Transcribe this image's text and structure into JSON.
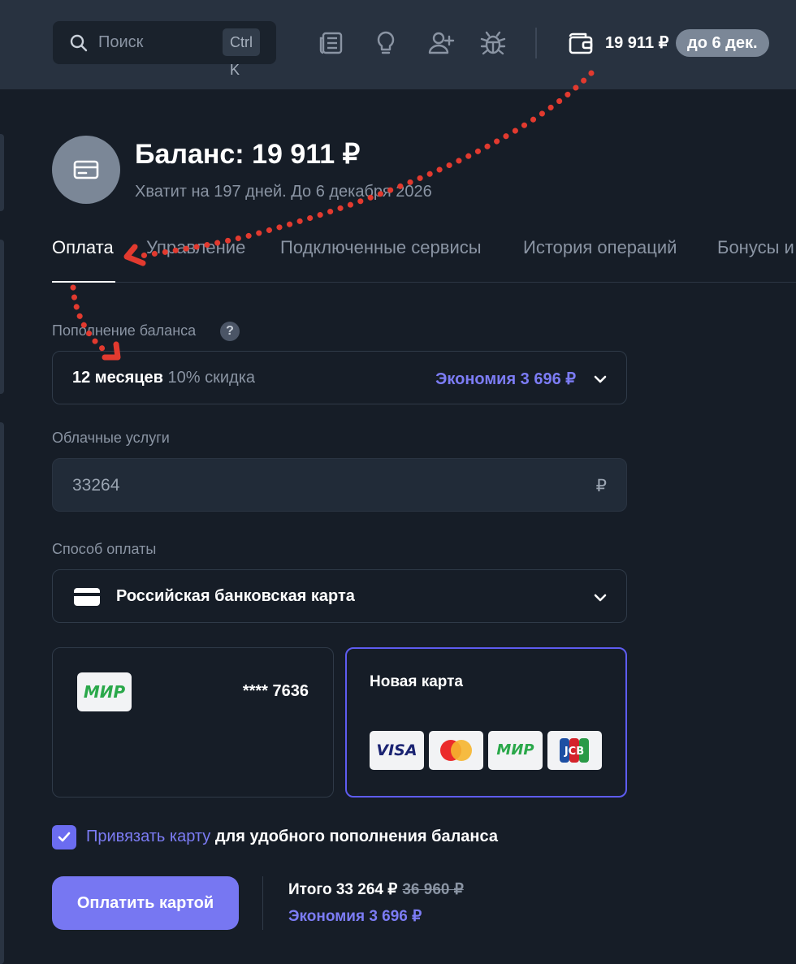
{
  "topbar": {
    "search_placeholder": "Поиск",
    "search_shortcut": "Ctrl K",
    "icons": [
      "news-icon",
      "lightbulb-icon",
      "add-user-icon",
      "bug-icon",
      "wallet-icon"
    ],
    "balance": "19 911 ₽",
    "badge": "до 6 дек."
  },
  "header": {
    "title": "Баланс: 19 911 ₽",
    "subtitle": "Хватит на 197 дней. До 6 декабря 2026"
  },
  "tabs": [
    "Оплата",
    "Управление",
    "Подключенные сервисы",
    "История операций",
    "Бонусы и"
  ],
  "form": {
    "topup_label": "Пополнение баланса",
    "help_mark": "?",
    "period": "12 месяцев",
    "discount": "10% скидка",
    "savings": "Экономия 3 696 ₽",
    "cloud_label": "Облачные услуги",
    "cloud_value": "33264",
    "currency": "₽",
    "method_label": "Способ оплаты",
    "method_value": "Российская банковская карта"
  },
  "cards": {
    "saved_brand": "МИР",
    "saved_number": "**** 7636",
    "new_card_label": "Новая карта",
    "brands": [
      "VISA",
      "Mastercard",
      "МИР",
      "JCB"
    ]
  },
  "bind": {
    "link": "Привязать карту",
    "rest": " для удобного пополнения баланса",
    "checked": true
  },
  "pay": {
    "button": "Оплатить картой",
    "total_label": "Итого 33 264 ₽",
    "old_price": "36 960 ₽",
    "savings": "Экономия 3 696 ₽"
  },
  "colors": {
    "bg": "#161d27",
    "topbar": "#283240",
    "accent": "#7777f2",
    "link": "#7c7cf5",
    "annotation": "#e23a2f"
  }
}
